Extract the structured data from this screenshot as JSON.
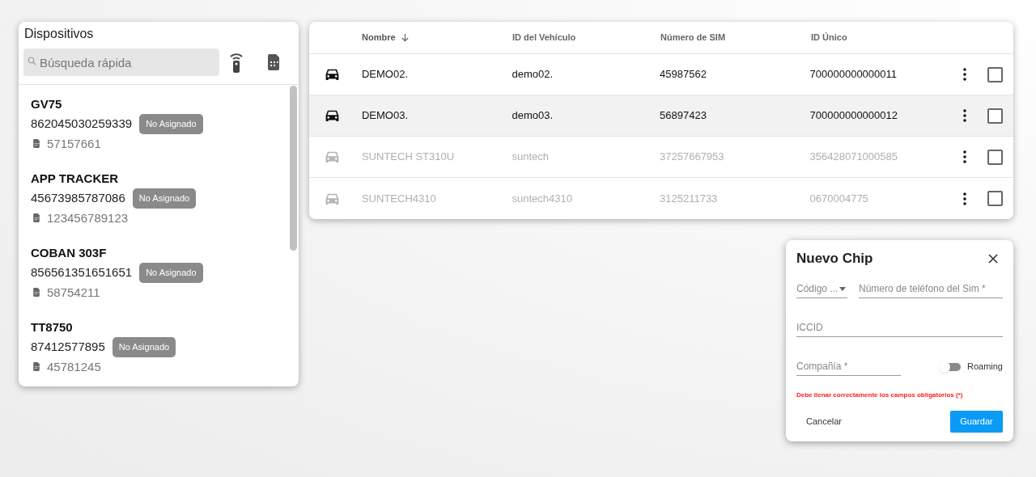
{
  "devices_panel": {
    "title": "Dispositivos",
    "search": {
      "placeholder": "Búsqueda rápida"
    },
    "devices": [
      {
        "name": "GV75",
        "imei": "862045030259339",
        "badge": "No Asignado",
        "sim": "57157661"
      },
      {
        "name": "APP TRACKER",
        "imei": "45673985787086",
        "badge": "No Asignado",
        "sim": "123456789123"
      },
      {
        "name": "COBAN 303F",
        "imei": "856561351651651",
        "badge": "No Asignado",
        "sim": "58754211"
      },
      {
        "name": "TT8750",
        "imei": "87412577895",
        "badge": "No Asignado",
        "sim": "45781245"
      }
    ]
  },
  "table": {
    "columns": [
      {
        "label": "Nombre",
        "sorted": true
      },
      {
        "label": "ID del Vehículo",
        "sorted": false
      },
      {
        "label": "Número de SIM",
        "sorted": false
      },
      {
        "label": "ID Único",
        "sorted": false
      }
    ],
    "rows": [
      {
        "cells": [
          "DEMO02.",
          "demo02.",
          "45987562",
          "700000000000011"
        ],
        "disabled": false,
        "hovered": false,
        "checked": false
      },
      {
        "cells": [
          "DEMO03.",
          "demo03.",
          "56897423",
          "700000000000012"
        ],
        "disabled": false,
        "hovered": true,
        "checked": false
      },
      {
        "cells": [
          "SUNTECH ST310U",
          "suntech",
          "37257667953",
          "356428071000585"
        ],
        "disabled": true,
        "hovered": false,
        "checked": false
      },
      {
        "cells": [
          "SUNTECH4310",
          "suntech4310",
          "3125211733",
          "0670004775"
        ],
        "disabled": true,
        "hovered": false,
        "checked": false
      }
    ]
  },
  "dialog": {
    "title": "Nuevo Chip",
    "code_select": {
      "placeholder": "Código ..."
    },
    "phone_field": {
      "placeholder": "Número de teléfono del Sim *"
    },
    "iccid_field": {
      "placeholder": "ICCID"
    },
    "company_field": {
      "placeholder": "Compañía *"
    },
    "roaming": {
      "label": "Roaming",
      "on": false
    },
    "error": "Debe llenar correctamente los campos obligatorios (*)",
    "buttons": [
      {
        "label": "Cancelar",
        "kind": "text"
      },
      {
        "label": "Guardar",
        "kind": "primary"
      }
    ]
  }
}
